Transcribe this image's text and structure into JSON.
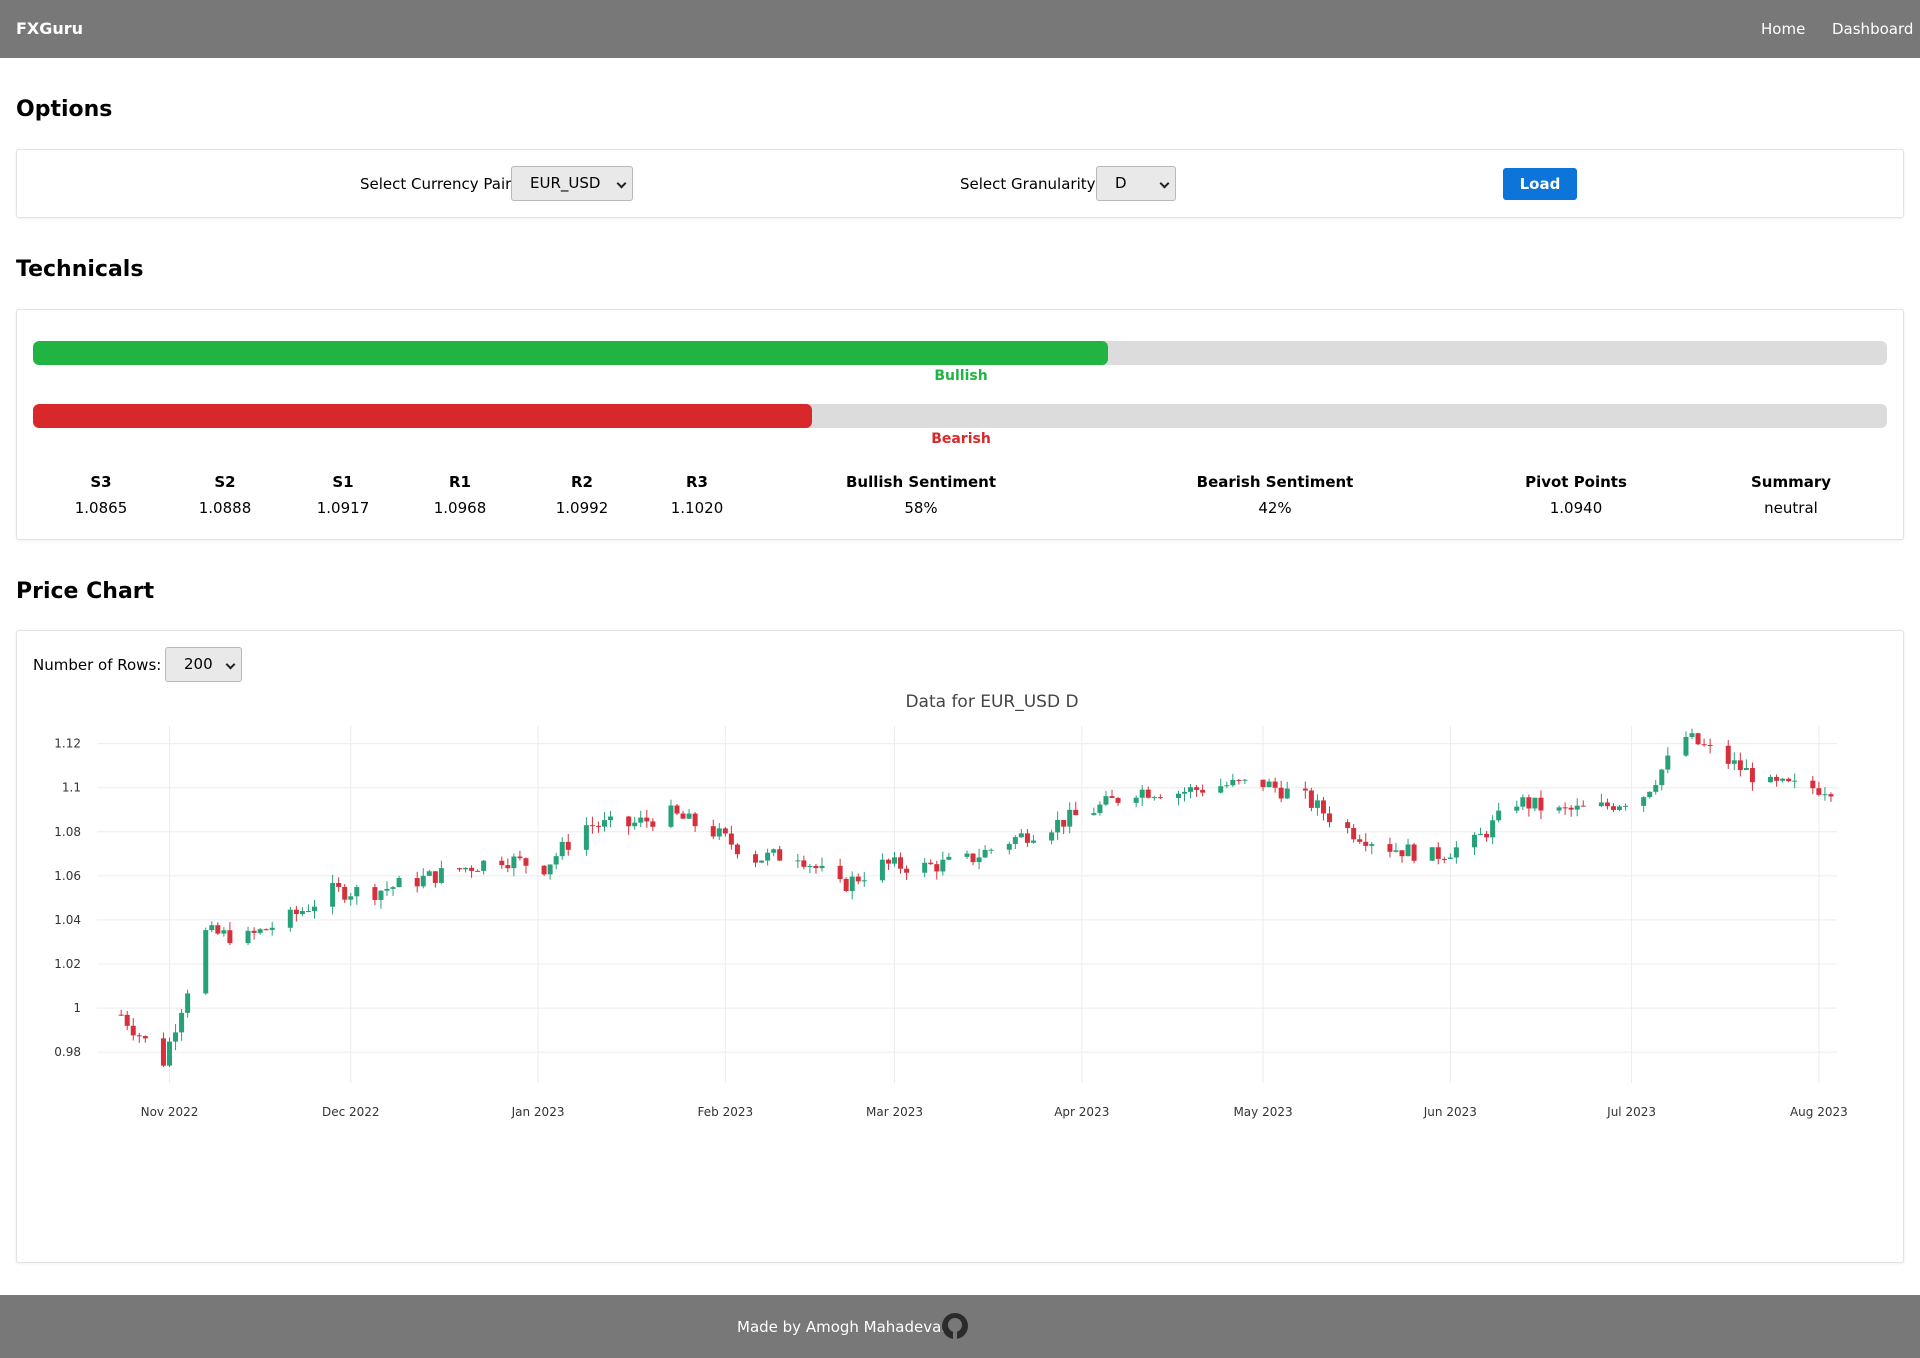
{
  "nav": {
    "brand": "FXGuru",
    "links": [
      "Home",
      "Dashboard"
    ]
  },
  "options": {
    "title": "Options",
    "pair_label": "Select Currency Pair",
    "pair_value": "EUR_USD",
    "granularity_label": "Select Granularity",
    "granularity_value": "D",
    "load_label": "Load"
  },
  "technicals": {
    "title": "Technicals",
    "bullish_label": "Bullish",
    "bearish_label": "Bearish",
    "bullish_fraction": 0.58,
    "bearish_fraction": 0.42,
    "colors": {
      "bullish": "#22b443",
      "bearish": "#d9282c"
    },
    "columns": [
      {
        "header": "S3",
        "value": "1.0865"
      },
      {
        "header": "S2",
        "value": "1.0888"
      },
      {
        "header": "S1",
        "value": "1.0917"
      },
      {
        "header": "R1",
        "value": "1.0968"
      },
      {
        "header": "R2",
        "value": "1.0992"
      },
      {
        "header": "R3",
        "value": "1.1020"
      },
      {
        "header": "Bullish Sentiment",
        "value": "58%"
      },
      {
        "header": "Bearish Sentiment",
        "value": "42%"
      },
      {
        "header": "Pivot Points",
        "value": "1.0940"
      },
      {
        "header": "Summary",
        "value": "neutral"
      }
    ]
  },
  "price_chart": {
    "title": "Price Chart",
    "rows_label": "Number of Rows:",
    "rows_value": "200"
  },
  "chart_data": {
    "type": "candlestick",
    "title": "Data for EUR_USD D",
    "xlabel": "",
    "ylabel": "",
    "ylim": [
      0.966,
      1.128
    ],
    "y_ticks": [
      0.98,
      1,
      1.02,
      1.04,
      1.06,
      1.08,
      1.1,
      1.12
    ],
    "y_tick_labels": [
      "0.98",
      "1",
      "1.02",
      "1.04",
      "1.06",
      "1.08",
      "1.1",
      "1.12"
    ],
    "x_ticks": [
      "2022-11-01",
      "2022-12-01",
      "2023-01-01",
      "2023-02-01",
      "2023-03-01",
      "2023-04-01",
      "2023-05-01",
      "2023-06-01",
      "2023-07-01",
      "2023-08-01"
    ],
    "x_tick_labels": [
      "Nov 2022",
      "Dec 2022",
      "Jan 2023",
      "Feb 2023",
      "Mar 2023",
      "Apr 2023",
      "May 2023",
      "Jun 2023",
      "Jul 2023",
      "Aug 2023"
    ],
    "xlim": [
      "2022-10-20",
      "2023-08-04"
    ],
    "grid": true,
    "colors": {
      "up": "#26a17a",
      "down": "#d5303c"
    },
    "weekly_close": [
      [
        "2022-10-24",
        0.997
      ],
      [
        "2022-10-31",
        0.976
      ],
      [
        "2022-11-07",
        1.034
      ],
      [
        "2022-11-14",
        1.032
      ],
      [
        "2022-11-21",
        1.041
      ],
      [
        "2022-11-28",
        1.053
      ],
      [
        "2022-12-05",
        1.053
      ],
      [
        "2022-12-12",
        1.058
      ],
      [
        "2022-12-19",
        1.063
      ],
      [
        "2022-12-26",
        1.068
      ],
      [
        "2023-01-02",
        1.064
      ],
      [
        "2023-01-09",
        1.083
      ],
      [
        "2023-01-16",
        1.083
      ],
      [
        "2023-01-23",
        1.088
      ],
      [
        "2023-01-30",
        1.08
      ],
      [
        "2023-02-06",
        1.068
      ],
      [
        "2023-02-13",
        1.07
      ],
      [
        "2023-02-20",
        1.055
      ],
      [
        "2023-02-27",
        1.065
      ],
      [
        "2023-03-06",
        1.064
      ],
      [
        "2023-03-13",
        1.067
      ],
      [
        "2023-03-20",
        1.076
      ],
      [
        "2023-03-27",
        1.083
      ],
      [
        "2023-04-03",
        1.09
      ],
      [
        "2023-04-10",
        1.099
      ],
      [
        "2023-04-17",
        1.098
      ],
      [
        "2023-04-24",
        1.101
      ],
      [
        "2023-05-01",
        1.102
      ],
      [
        "2023-05-08",
        1.095
      ],
      [
        "2023-05-15",
        1.081
      ],
      [
        "2023-05-22",
        1.073
      ],
      [
        "2023-05-29",
        1.069
      ],
      [
        "2023-06-05",
        1.075
      ],
      [
        "2023-06-12",
        1.094
      ],
      [
        "2023-06-19",
        1.089
      ],
      [
        "2023-06-26",
        1.091
      ],
      [
        "2023-07-03",
        1.097
      ],
      [
        "2023-07-10",
        1.123
      ],
      [
        "2023-07-17",
        1.112
      ],
      [
        "2023-07-24",
        1.101
      ],
      [
        "2023-07-31",
        1.1
      ]
    ]
  },
  "footer": {
    "text": "Made by Amogh Mahadevan"
  }
}
